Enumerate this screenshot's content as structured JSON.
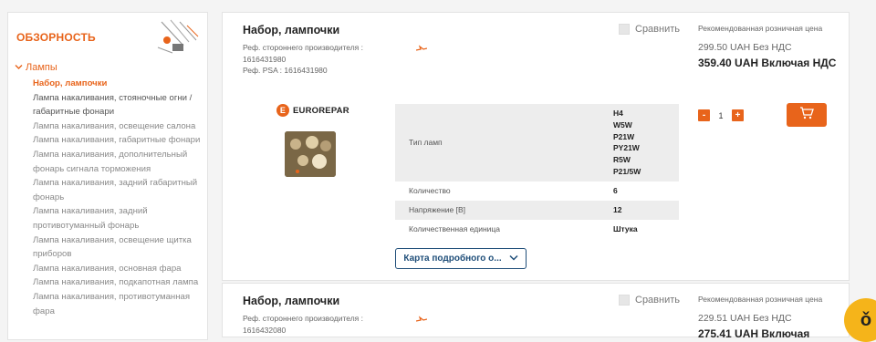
{
  "sidebar": {
    "title": "ОБЗОРНОСТЬ",
    "group": "Лампы",
    "items": [
      "Набор, лампочки",
      "Лампа накаливания, стояночные огни / габаритные фонари",
      "Лампа накаливания, освещение салона",
      "Лампа накаливания, габаритные фонари",
      "Лампа накаливания, дополнительный фонарь сигнала торможения",
      "Лампа накаливания, задний габаритный фонарь",
      "Лампа накаливания, задний противотуманный фонарь",
      "Лампа накаливания, освещение щитка приборов",
      "Лампа накаливания, основная фара",
      "Лампа накаливания, подкапотная лампа",
      "Лампа накаливания, противотуманная фара"
    ]
  },
  "products": [
    {
      "title": "Набор, лампочки",
      "ref_lines": [
        "Реф. стороннего производителя :",
        "1616431980",
        "Реф. PSA : 1616431980"
      ],
      "compare_label": "Сравнить",
      "price_label": "Рекомендованная розничная цена",
      "price_net": "299.50 UAH Без НДС",
      "price_gross": "359.40 UAH Включая НДС",
      "brand": "EUROREPAR",
      "specs": [
        {
          "label": "Тип ламп",
          "values": [
            "H4",
            "W5W",
            "P21W",
            "PY21W",
            "R5W",
            "P21/5W"
          ]
        },
        {
          "label": "Количество",
          "values": [
            "6"
          ]
        },
        {
          "label": "Напряжение [В]",
          "values": [
            "12"
          ]
        },
        {
          "label": "Количественная единица",
          "values": [
            "Штука"
          ]
        }
      ],
      "more_label": "Карта подробного о...",
      "qty": "1"
    },
    {
      "title": "Набор, лампочки",
      "ref_lines": [
        "Реф. стороннего производителя :",
        "1616432080"
      ],
      "compare_label": "Сравнить",
      "price_label": "Рекомендованная розничная цена",
      "price_net": "229.51 UAH Без НДС",
      "price_gross": "275.41 UAH Включая"
    }
  ],
  "colors": {
    "accent": "#e8641b",
    "link": "#1f4e79",
    "fab": "#f5b41a"
  },
  "icons": {
    "cart": "cart-icon",
    "chevron": "chevron-down-icon",
    "fab": "assistant-icon"
  },
  "fab_glyph": "ǒ"
}
